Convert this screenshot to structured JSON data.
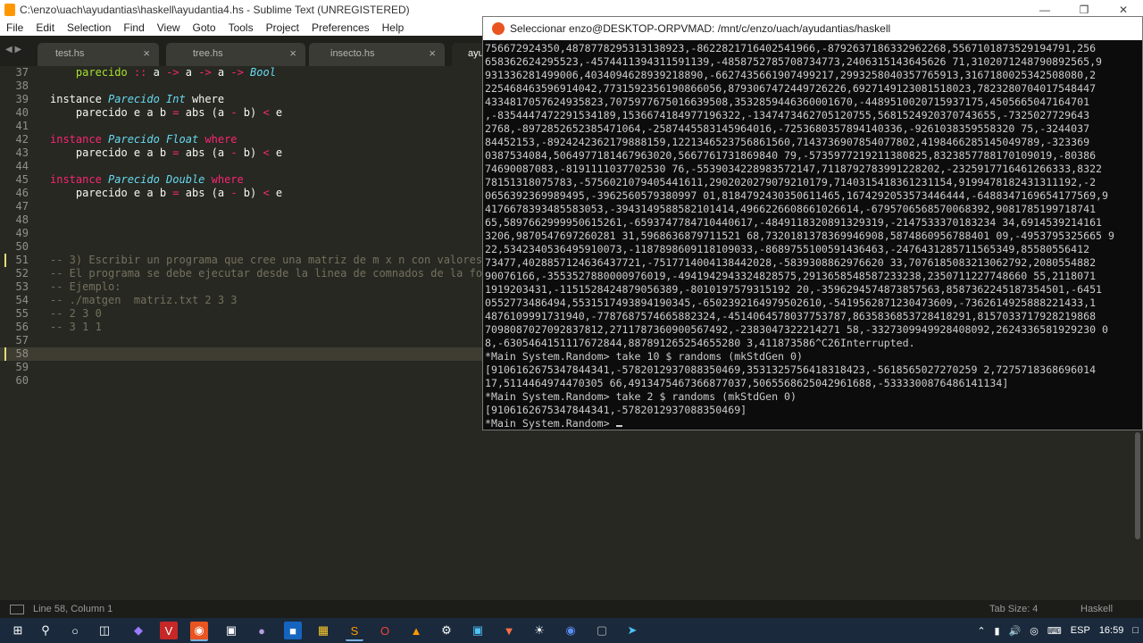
{
  "sublime": {
    "title": "C:\\enzo\\uach\\ayudantias\\haskell\\ayudantia4.hs - Sublime Text (UNREGISTERED)",
    "menu": [
      "File",
      "Edit",
      "Selection",
      "Find",
      "View",
      "Goto",
      "Tools",
      "Project",
      "Preferences",
      "Help"
    ],
    "tabs": [
      "test.hs",
      "tree.hs",
      "insecto.hs",
      "ayu"
    ],
    "status_left": "Line 58, Column 1",
    "status_tabsize": "Tab Size: 4",
    "status_syntax": "Haskell"
  },
  "editor": {
    "lines": [
      {
        "n": "37",
        "parts": [
          [
            "",
            "    "
          ],
          [
            "fn",
            "parecido"
          ],
          [
            "",
            " "
          ],
          [
            "k",
            "::"
          ],
          [
            "",
            " a "
          ],
          [
            "k",
            "->"
          ],
          [
            "",
            " a "
          ],
          [
            "k",
            "->"
          ],
          [
            "",
            " a "
          ],
          [
            "k",
            "->"
          ],
          [
            "",
            " "
          ],
          [
            "ty",
            "Bool"
          ]
        ]
      },
      {
        "n": "38",
        "parts": []
      },
      {
        "n": "39",
        "parts": [
          [
            "",
            "instance "
          ],
          [
            "ty",
            "Parecido Int"
          ],
          [
            "",
            " where"
          ]
        ]
      },
      {
        "n": "40",
        "parts": [
          [
            "",
            "    parecido e a b "
          ],
          [
            "k",
            "="
          ],
          [
            "",
            " abs (a "
          ],
          [
            "k",
            "-"
          ],
          [
            "",
            " b) "
          ],
          [
            "k",
            "<"
          ],
          [
            "",
            " e"
          ]
        ]
      },
      {
        "n": "41",
        "parts": []
      },
      {
        "n": "42",
        "parts": [
          [
            "k",
            "instance "
          ],
          [
            "ty",
            "Parecido Float"
          ],
          [
            "k",
            " where"
          ]
        ]
      },
      {
        "n": "43",
        "parts": [
          [
            "",
            "    parecido e a b "
          ],
          [
            "k",
            "="
          ],
          [
            "",
            " abs (a "
          ],
          [
            "k",
            "-"
          ],
          [
            "",
            " b) "
          ],
          [
            "k",
            "<"
          ],
          [
            "",
            " e"
          ]
        ]
      },
      {
        "n": "44",
        "parts": []
      },
      {
        "n": "45",
        "parts": [
          [
            "k",
            "instance "
          ],
          [
            "ty",
            "Parecido Double"
          ],
          [
            "k",
            " where"
          ]
        ]
      },
      {
        "n": "46",
        "parts": [
          [
            "",
            "    parecido e a b "
          ],
          [
            "k",
            "="
          ],
          [
            "",
            " abs (a "
          ],
          [
            "k",
            "-"
          ],
          [
            "",
            " b) "
          ],
          [
            "k",
            "<"
          ],
          [
            "",
            " e"
          ]
        ]
      },
      {
        "n": "47",
        "parts": []
      },
      {
        "n": "48",
        "parts": []
      },
      {
        "n": "49",
        "parts": []
      },
      {
        "n": "50",
        "parts": []
      },
      {
        "n": "51",
        "parts": [
          [
            "cm",
            "-- 3) Escribir un programa que cree una matriz de m x n con valores"
          ]
        ]
      },
      {
        "n": "52",
        "parts": [
          [
            "cm",
            "-- El programa se debe ejecutar desde la linea de comnados de la fo"
          ]
        ]
      },
      {
        "n": "53",
        "parts": [
          [
            "cm",
            "-- Ejemplo:"
          ]
        ]
      },
      {
        "n": "54",
        "parts": [
          [
            "cm",
            "-- ./matgen  matriz.txt 2 3 3"
          ]
        ]
      },
      {
        "n": "55",
        "parts": [
          [
            "cm",
            "-- 2 3 0"
          ]
        ]
      },
      {
        "n": "56",
        "parts": [
          [
            "cm",
            "-- 3 1 1"
          ]
        ]
      },
      {
        "n": "57",
        "parts": []
      },
      {
        "n": "58",
        "parts": []
      },
      {
        "n": "59",
        "parts": []
      },
      {
        "n": "60",
        "parts": []
      }
    ]
  },
  "terminal": {
    "title": "Seleccionar enzo@DESKTOP-ORPVMAD: /mnt/c/enzo/uach/ayudantias/haskell",
    "lines": [
      "756672924350,4878778295313138923,-8622821716402541966,-8792637186332962268,5567101873529194791,256",
      "658362624295523,-4574411394311591139,-4858752785708734773,2406315143645626 71,3102071248790892565,9",
      "931336281499006,4034094628939218890,-6627435661907499217,2993258040357765913,3167180025342508080,2",
      "225468463596914042,7731592356190866056,8793067472449726226,6927149123081518023,7823280704017548447",
      "4334817057624935823,7075977675016639508,3532859446360001670,-4489510020715937175,4505665047164701",
      ",-8354447472291534189,1536674184977196322,-1347473462705120755,5681524920370743655,-7325027729643",
      "2768,-8972852652385471064,-2587445583145964016,-7253680357894140336,-9261038359558320 75,-3244037",
      "84452153,-8924242362179888159,1221346523756861560,7143736907854077802,4198466285145049789,-323369",
      "0387534084,5064977181467963020,5667761731869840 79,-5735977219211380825,8323857788170109019,-80386",
      "74690087083,-8191111037702530 76,-5539034228983572147,7118792783991228202,-2325917716461266333,8322",
      "78151318075783,-5756021079405441611,2902020279079210179,7140315418361231154,9199478182431311192,-2",
      "0656392369989495,-3962560579380997 01,8184792430350611465,1674292053573446444,-6488347169654177569,9",
      "4176678393485583053,-3943149588582101414,4966226608661026614,-6795706568570068392,9081785199718741",
      "65,5897662999950615261,-6593747784710440617,-4849118320891329319,-2147533370183234 34,6914539214161",
      "3206,9870547697260281 31,5968636879711521 68,7320181378369946908,5874860956788401 09,-4953795325665 9",
      "22,5342340536495910073,-1187898609118109033,-8689755100591436463,-2476431285711565349,85580556412",
      "73477,4028857124636437721,-7517714004138442028,-5839308862976620 33,7076185083213062792,2080554882",
      "90076166,-3553527880000976019,-4941942943324828575,2913658548587233238,2350711227748660 55,2118071",
      "1919203431,-1151528424879056389,-8010197579315192 20,-3596294574873857563,8587362245187354501,-6451",
      "0552773486494,5531517493894190345,-6502392164979502610,-5419562871230473609,-7362614925888221433,1",
      "4876109991731940,-7787687574665882324,-4514064578037753787,8635836853728418291,8157033717928219868",
      "7098087027092837812,2711787360900567492,-2383047322214271 58,-3327309949928408092,2624336581929230 0",
      "8,-6305464151117672844,887891265254655280 3,411873586^C26Interrupted.",
      "*Main System.Random> take 10 $ randoms (mkStdGen 0)",
      "[9106162675347844341,-5782012937088350469,3531325756418318423,-5618565027270259 2,7275718368696014",
      "17,5114464974470305 66,4913475467366877037,5065568625042961688,-5333300876486141134]",
      "*Main System.Random> take 2 $ randoms (mkStdGen 0)",
      "[9106162675347844341,-5782012937088350469]",
      "*Main System.Random> "
    ]
  },
  "taskbar": {
    "lang": "ESP",
    "time": "16:59"
  }
}
